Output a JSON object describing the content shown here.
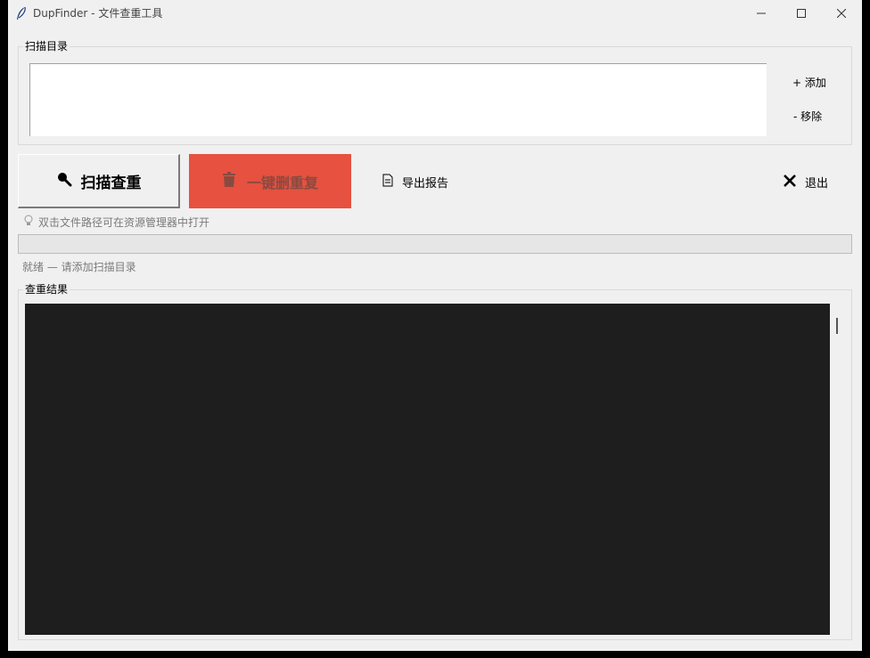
{
  "window": {
    "title": "DupFinder - 文件查重工具",
    "controls": [
      "minimize-icon",
      "maximize-icon",
      "close-icon"
    ]
  },
  "scan_dirs": {
    "group_label": "扫描目录",
    "entries": [],
    "add_label": "+ 添加",
    "remove_label": "- 移除"
  },
  "toolbar": {
    "scan_label": "扫描查重",
    "scan_icon": "magnifier-icon",
    "delete_label": "一键删重复",
    "delete_icon": "trash-icon",
    "delete_color": "#e65140",
    "export_label": "导出报告",
    "export_icon": "document-icon",
    "exit_label": "退出",
    "exit_icon": "x-icon"
  },
  "hint": {
    "icon": "lightbulb-icon",
    "text": "双击文件路径可在资源管理器中打开"
  },
  "progress": {
    "value": 0
  },
  "status": {
    "text": "就绪 — 请添加扫描目录"
  },
  "results": {
    "group_label": "查重结果",
    "background": "#1e1e1e",
    "lines": []
  }
}
